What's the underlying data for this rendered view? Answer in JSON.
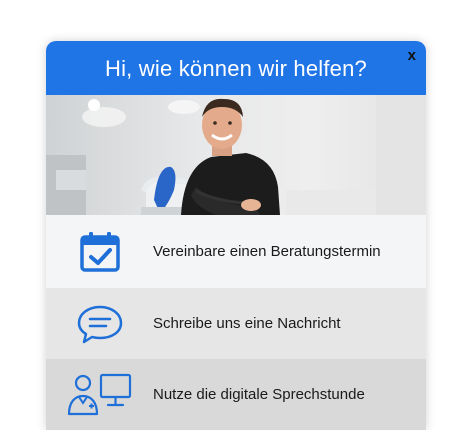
{
  "header": {
    "title": "Hi, wie können wir helfen?",
    "close_label": "x"
  },
  "hero": {
    "icon": "photo-dentist-in-practice"
  },
  "options": [
    {
      "label": "Vereinbare einen Beratungstermin",
      "icon": "calendar-check-icon"
    },
    {
      "label": "Schreibe uns eine Nachricht",
      "icon": "chat-bubble-icon"
    },
    {
      "label": "Nutze die digitale Sprechstunde",
      "icon": "video-consultation-icon"
    }
  ],
  "colors": {
    "accent": "#1f74e6",
    "icon": "#1f6fd8"
  }
}
